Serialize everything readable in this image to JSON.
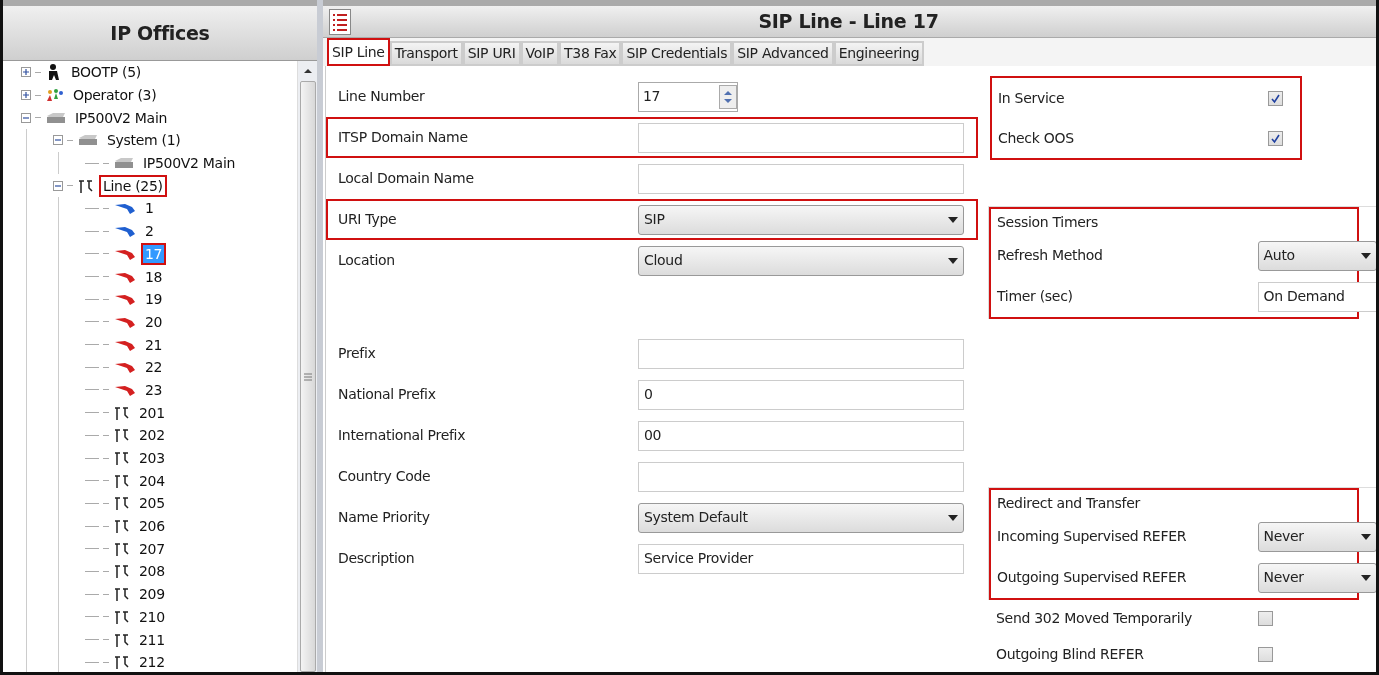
{
  "tree": {
    "title": "IP Offices",
    "items": [
      {
        "label": "BOOTP (5)",
        "kind": "person",
        "expanded": false,
        "selected": false,
        "highlighted": false
      },
      {
        "label": "Operator (3)",
        "kind": "people",
        "expanded": false,
        "selected": false,
        "highlighted": false
      },
      {
        "label": "IP500V2 Main",
        "kind": "router",
        "expanded": true,
        "selected": false,
        "highlighted": false,
        "children": [
          {
            "label": "System (1)",
            "kind": "router",
            "expanded": true,
            "selected": false,
            "highlighted": false,
            "children": [
              {
                "label": "IP500V2 Main",
                "kind": "router",
                "selected": false,
                "highlighted": false
              }
            ]
          },
          {
            "label": "Line (25)",
            "kind": "lines",
            "expanded": true,
            "selected": false,
            "highlighted": true,
            "children": [
              {
                "label": "1",
                "kind": "cable",
                "color": "#1f5fd0",
                "selected": false,
                "highlighted": false
              },
              {
                "label": "2",
                "kind": "cable",
                "color": "#1f5fd0",
                "selected": false,
                "highlighted": false
              },
              {
                "label": "17",
                "kind": "cable",
                "color": "#d42020",
                "selected": true,
                "highlighted": true
              },
              {
                "label": "18",
                "kind": "cable",
                "color": "#d42020",
                "selected": false,
                "highlighted": false
              },
              {
                "label": "19",
                "kind": "cable",
                "color": "#d42020",
                "selected": false,
                "highlighted": false
              },
              {
                "label": "20",
                "kind": "cable",
                "color": "#d42020",
                "selected": false,
                "highlighted": false
              },
              {
                "label": "21",
                "kind": "cable",
                "color": "#d42020",
                "selected": false,
                "highlighted": false
              },
              {
                "label": "22",
                "kind": "cable",
                "color": "#d42020",
                "selected": false,
                "highlighted": false
              },
              {
                "label": "23",
                "kind": "cable",
                "color": "#d42020",
                "selected": false,
                "highlighted": false
              },
              {
                "label": "201",
                "kind": "lines",
                "selected": false,
                "highlighted": false
              },
              {
                "label": "202",
                "kind": "lines",
                "selected": false,
                "highlighted": false
              },
              {
                "label": "203",
                "kind": "lines",
                "selected": false,
                "highlighted": false
              },
              {
                "label": "204",
                "kind": "lines",
                "selected": false,
                "highlighted": false
              },
              {
                "label": "205",
                "kind": "lines",
                "selected": false,
                "highlighted": false
              },
              {
                "label": "206",
                "kind": "lines",
                "selected": false,
                "highlighted": false
              },
              {
                "label": "207",
                "kind": "lines",
                "selected": false,
                "highlighted": false
              },
              {
                "label": "208",
                "kind": "lines",
                "selected": false,
                "highlighted": false
              },
              {
                "label": "209",
                "kind": "lines",
                "selected": false,
                "highlighted": false
              },
              {
                "label": "210",
                "kind": "lines",
                "selected": false,
                "highlighted": false
              },
              {
                "label": "211",
                "kind": "lines",
                "selected": false,
                "highlighted": false
              },
              {
                "label": "212",
                "kind": "lines",
                "selected": false,
                "highlighted": false
              }
            ]
          }
        ]
      }
    ]
  },
  "main": {
    "title": "SIP Line - Line 17",
    "tabs": [
      {
        "label": "SIP Line",
        "selected": true,
        "highlighted": true
      },
      {
        "label": "Transport",
        "selected": false,
        "highlighted": false
      },
      {
        "label": "SIP URI",
        "selected": false,
        "highlighted": false
      },
      {
        "label": "VoIP",
        "selected": false,
        "highlighted": false
      },
      {
        "label": "T38 Fax",
        "selected": false,
        "highlighted": false
      },
      {
        "label": "SIP Credentials",
        "selected": false,
        "highlighted": false
      },
      {
        "label": "SIP Advanced",
        "selected": false,
        "highlighted": false
      },
      {
        "label": "Engineering",
        "selected": false,
        "highlighted": false
      }
    ],
    "form_top": [
      {
        "label": "Line Number",
        "kind": "spin",
        "value": "17",
        "highlighted": false
      },
      {
        "label": "ITSP Domain Name",
        "kind": "text",
        "highlighted": true
      },
      {
        "label": "Local Domain Name",
        "kind": "text",
        "highlighted": false
      },
      {
        "label": "URI Type",
        "kind": "select",
        "value": "SIP",
        "highlighted": true
      },
      {
        "label": "Location",
        "kind": "select",
        "value": "Cloud",
        "highlighted": false
      }
    ],
    "form_bottom": [
      {
        "label": "Prefix",
        "kind": "text",
        "highlighted": false
      },
      {
        "label": "National Prefix",
        "kind": "text",
        "value": "0",
        "highlighted": false
      },
      {
        "label": "International Prefix",
        "kind": "text",
        "value": "00",
        "highlighted": false
      },
      {
        "label": "Country Code",
        "kind": "text",
        "highlighted": false
      },
      {
        "label": "Name Priority",
        "kind": "select",
        "value": "System Default",
        "highlighted": false
      },
      {
        "label": "Description",
        "kind": "text",
        "value": "Service Provider",
        "highlighted": false
      }
    ],
    "service": {
      "highlighted": true,
      "items": [
        {
          "label": "In Service",
          "checked": true
        },
        {
          "label": "Check OOS",
          "checked": true
        }
      ]
    },
    "session_timers": {
      "title": "Session Timers",
      "highlighted": true,
      "rows": [
        {
          "label": "Refresh Method",
          "kind": "select",
          "value": "Auto"
        },
        {
          "label": "Timer (sec)",
          "kind": "text",
          "value": "On Demand"
        }
      ]
    },
    "redirect": {
      "title": "Redirect and Transfer",
      "highlighted": true,
      "rows": [
        {
          "label": "Incoming Supervised REFER",
          "kind": "select",
          "value": "Never"
        },
        {
          "label": "Outgoing Supervised REFER",
          "kind": "select",
          "value": "Never"
        }
      ]
    },
    "options": [
      {
        "label": "Send 302 Moved Temporarily",
        "checked": false
      },
      {
        "label": "Outgoing Blind REFER",
        "checked": false
      }
    ]
  }
}
